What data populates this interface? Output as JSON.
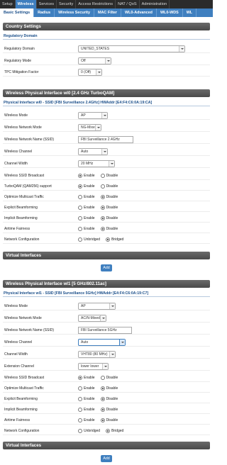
{
  "topnav": {
    "tabs": [
      "Setup",
      "Wireless",
      "Services",
      "Security",
      "Access Restrictions",
      "NAT / QoS",
      "Administration"
    ],
    "active": "Wireless"
  },
  "subnav": {
    "tabs": [
      "Basic Settings",
      "Radius",
      "Wireless Security",
      "MAC Filter",
      "WL0-Advanced",
      "WL0-WDS",
      "WL"
    ],
    "active": "Basic Settings"
  },
  "country": {
    "title": "Country Settings",
    "legend": "Regulatory Domain",
    "rows": [
      {
        "label": "Regulatory Domain",
        "value": "UNITED_STATES"
      },
      {
        "label": "Regulatory Mode",
        "value": "Off"
      },
      {
        "label": "TPC Mitigation Factor",
        "value": "0 (Off)"
      }
    ]
  },
  "wl0": {
    "title": "Wireless Physical Interface wl0 [2.4 GHz TurboQAM]",
    "legend": "Physical Interface wl0 - SSID [FBI Surveillance 2.4GHz] HWAddr [E4:F4:C6:0A:19:CA]",
    "wireless_mode": {
      "label": "Wireless Mode",
      "value": "AP"
    },
    "network_mode": {
      "label": "Wireless Network Mode",
      "value": "NG-Mixed"
    },
    "ssid": {
      "label": "Wireless Network Name (SSID)",
      "value": "FBI Surveillance 2.4GHz"
    },
    "channel": {
      "label": "Wireless Channel",
      "value": "Auto"
    },
    "width": {
      "label": "Channel Width",
      "value": "20 MHz"
    },
    "radios": [
      {
        "label": "Wireless SSID Broadcast",
        "a": "Enable",
        "b": "Disable",
        "checked": "a"
      },
      {
        "label": "TurboQAM (QAM256) support",
        "a": "Enable",
        "b": "Disable",
        "checked": "a"
      },
      {
        "label": "Optimize Multicast Traffic",
        "a": "Enable",
        "b": "Disable",
        "checked": "b"
      },
      {
        "label": "Explicit Beamforming",
        "a": "Enable",
        "b": "Disable",
        "checked": "b"
      },
      {
        "label": "Implicit Beamforming",
        "a": "Enable",
        "b": "Disable",
        "checked": "b"
      },
      {
        "label": "Airtime Fairness",
        "a": "Enable",
        "b": "Disable",
        "checked": "b"
      },
      {
        "label": "Network Configuration",
        "a": "Unbridged",
        "b": "Bridged",
        "checked": "b"
      }
    ]
  },
  "virtual1": {
    "title": "Virtual Interfaces",
    "add_label": "Add"
  },
  "wl1": {
    "title": "Wireless Physical Interface wl1 [5 GHz/802.11ac]",
    "legend": "Physical Interface wl1 - SSID [FBI Surveillance 5GHz] HWAddr [E4:F4:C6:0A:19:C7]",
    "wireless_mode": {
      "label": "Wireless Mode",
      "value": "AP"
    },
    "network_mode": {
      "label": "Wireless Network Mode",
      "value": "AC/N-Mixed"
    },
    "ssid": {
      "label": "Wireless Network Name (SSID)",
      "value": "FBI Surveillance 5GHz"
    },
    "channel": {
      "label": "Wireless Channel",
      "value": "Auto"
    },
    "width": {
      "label": "Channel Width",
      "value": "VHT80 (80 MHz)"
    },
    "ext": {
      "label": "Extension Channel",
      "value": "lower lower"
    },
    "radios": [
      {
        "label": "Wireless SSID Broadcast",
        "a": "Enable",
        "b": "Disable",
        "checked": "a"
      },
      {
        "label": "Optimize Multicast Traffic",
        "a": "Enable",
        "b": "Disable",
        "checked": "b"
      },
      {
        "label": "Explicit Beamforming",
        "a": "Enable",
        "b": "Disable",
        "checked": "b"
      },
      {
        "label": "Implicit Beamforming",
        "a": "Enable",
        "b": "Disable",
        "checked": "b"
      },
      {
        "label": "Airtime Fairness",
        "a": "Enable",
        "b": "Disable",
        "checked": "b"
      },
      {
        "label": "Network Configuration",
        "a": "Unbridged",
        "b": "Bridged",
        "checked": "b"
      }
    ]
  },
  "virtual2": {
    "title": "Virtual Interfaces",
    "add_label": "Add"
  }
}
